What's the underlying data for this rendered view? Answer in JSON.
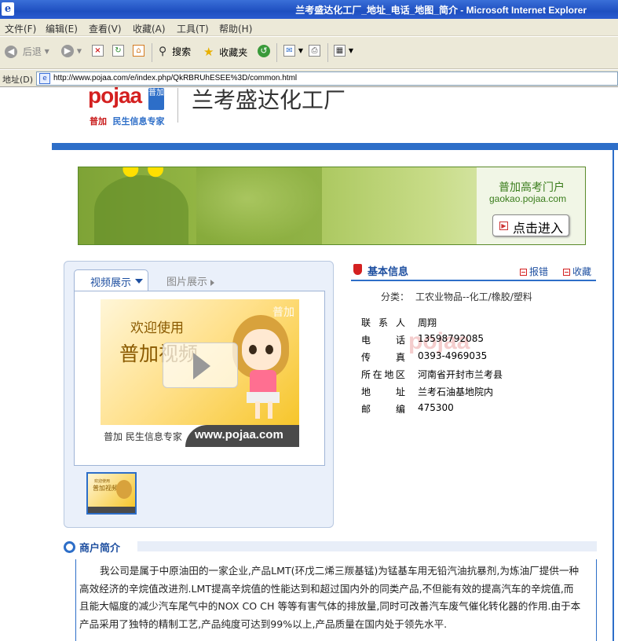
{
  "window": {
    "title": "兰考盛达化工厂_地址_电话_地图_简介 - Microsoft Internet Explorer"
  },
  "menu": [
    "文件(F)",
    "编辑(E)",
    "查看(V)",
    "收藏(A)",
    "工具(T)",
    "帮助(H)"
  ],
  "toolbar": {
    "back_label": "后退",
    "search_label": "搜索",
    "favorites_label": "收藏夹"
  },
  "address": {
    "label": "地址(D)",
    "url": "http://www.pojaa.com/e/index.php/QkRBRUhESEE%3D/common.html"
  },
  "site": {
    "logo_text": "pojaa",
    "logo_badge": "普加",
    "tag_red": "普加",
    "tag_blue": "民生信息专家",
    "company_name": "兰考盛达化工厂"
  },
  "banner": {
    "title": "普加高考门户",
    "url": "gaokao.pojaa.com",
    "button_label": "点击进入"
  },
  "media": {
    "tab_video": "视频展示",
    "tab_photo": "图片展示",
    "video_welcome": "欢迎使用",
    "video_title": "普加视频",
    "video_corner": "普加",
    "video_tag": "普加 民生信息专家",
    "video_site": "www.pojaa.com",
    "thumb_line1": "欢迎使用",
    "thumb_line2": "普加视频"
  },
  "info": {
    "title": "基本信息",
    "report_label": "报错",
    "favorite_label": "收藏",
    "category_label": "分类：",
    "category_value": "工农业物品--化工/橡胶/塑料",
    "rows": [
      {
        "key": "联系人",
        "value": "周翔"
      },
      {
        "key": "电话",
        "value": "13598792085"
      },
      {
        "key": "传真",
        "value": "0393-4969035"
      },
      {
        "key": "所在地区",
        "value": "河南省开封市兰考县"
      },
      {
        "key": "地址",
        "value": "兰考石油基地院内"
      },
      {
        "key": "邮编",
        "value": "475300"
      }
    ],
    "watermark": "pojaa"
  },
  "intro": {
    "title": "商户简介",
    "text": "我公司是属于中原油田的一家企业,产品LMT(环戊二烯三羰基锰)为锰基车用无铅汽油抗暴剂,为炼油厂提供一种高效经济的辛烷值改进剂.LMT提高辛烷值的性能达到和超过国内外的同类产品,不但能有效的提高汽车的辛烷值,而且能大幅度的减少汽车尾气中的NOX CO CH 等等有害气体的排放量,同时可改善汽车废气催化转化器的作用.由于本产品采用了独特的精制工艺,产品纯度可达到99%以上,产品质量在国内处于领先水平."
  }
}
